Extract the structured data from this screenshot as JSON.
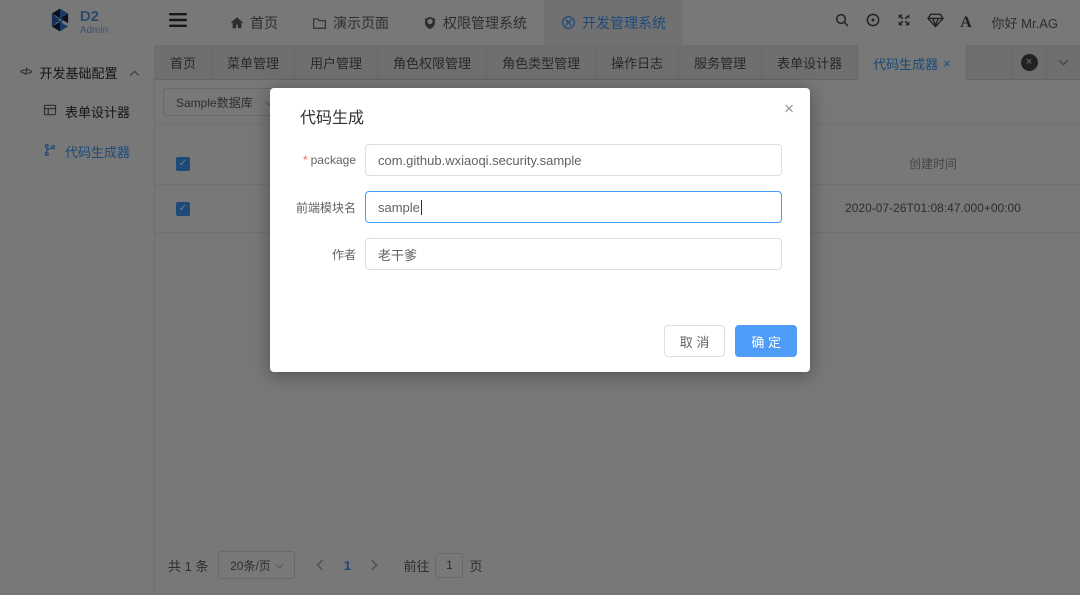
{
  "colors": {
    "primary": "#409EFF",
    "confirm_button": "#4e9cf7",
    "required_star": "#f56c6c"
  },
  "header": {
    "logo_title": "D2",
    "logo_subtitle": "Admin",
    "nav": [
      {
        "label": "首页"
      },
      {
        "label": "演示页面"
      },
      {
        "label": "权限管理系统"
      },
      {
        "label": "开发管理系统"
      }
    ],
    "greeting": "你好 Mr.AG"
  },
  "sidebar": {
    "group_label": "开发基础配置",
    "group_icon": "</>",
    "items": [
      {
        "label": "表单设计器"
      },
      {
        "label": "代码生成器"
      }
    ]
  },
  "tabs": {
    "items": [
      {
        "label": "首页"
      },
      {
        "label": "菜单管理"
      },
      {
        "label": "用户管理"
      },
      {
        "label": "角色权限管理"
      },
      {
        "label": "角色类型管理"
      },
      {
        "label": "操作日志"
      },
      {
        "label": "服务管理"
      },
      {
        "label": "表单设计器"
      },
      {
        "label": "代码生成器"
      }
    ],
    "active_close": "×"
  },
  "content": {
    "db_select_value": "Sample数据库",
    "table": {
      "created_header": "创建时间",
      "rows": [
        {
          "created": "2020-07-26T01:08:47.000+00:00"
        }
      ]
    }
  },
  "pagination": {
    "total": "共 1 条",
    "page_size": "20条/页",
    "current_page": "1",
    "goto_label": "前往",
    "goto_value": "1",
    "page_unit": "页"
  },
  "dialog": {
    "title": "代码生成",
    "close": "×",
    "required_mark": "*",
    "fields": [
      {
        "label": "package",
        "value": "com.github.wxiaoqi.security.sample"
      },
      {
        "label": "前端模块名",
        "value": "sample"
      },
      {
        "label": "作者",
        "value": "老干爹"
      }
    ],
    "cancel_label": "取 消",
    "confirm_label": "确 定"
  }
}
